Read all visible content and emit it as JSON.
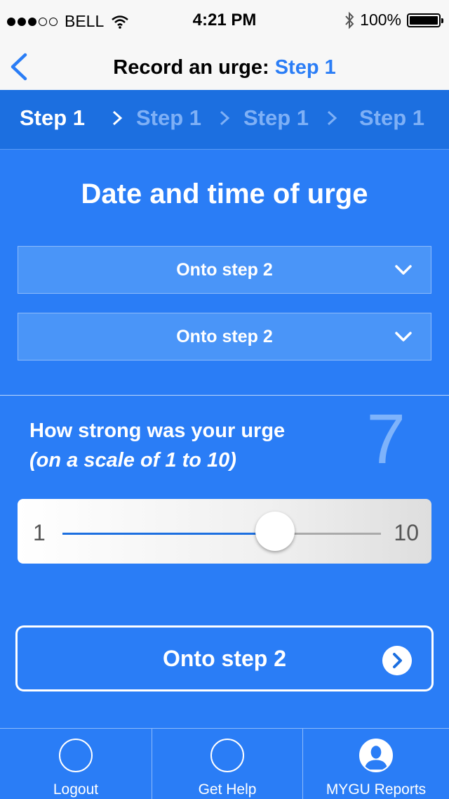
{
  "status_bar": {
    "carrier": "BELL",
    "time": "4:21 PM",
    "battery": "100%"
  },
  "nav": {
    "title_prefix": "Record an urge:",
    "title_step": "Step 1"
  },
  "steps": [
    {
      "label": "Step 1",
      "active": true
    },
    {
      "label": "Step 1",
      "active": false
    },
    {
      "label": "Step 1",
      "active": false
    },
    {
      "label": "Step 1",
      "active": false
    }
  ],
  "form": {
    "heading": "Date and time of urge",
    "dropdown_date": "Onto step 2",
    "dropdown_time": "Onto step 2",
    "question_line1": "How strong was your urge",
    "question_line2": "(on a scale of 1 to 10)",
    "strength_value": "7",
    "slider": {
      "min": "1",
      "max": "10",
      "value": 7
    },
    "next_button": "Onto step 2"
  },
  "tabs": [
    {
      "label": "Logout",
      "icon": "circle-icon"
    },
    {
      "label": "Get Help",
      "icon": "circle-icon"
    },
    {
      "label": "MYGU Reports",
      "icon": "user-icon"
    }
  ],
  "colors": {
    "background": "#2a7df6",
    "steps_bar": "#1c6fe0",
    "accent": "#2a7df6"
  }
}
